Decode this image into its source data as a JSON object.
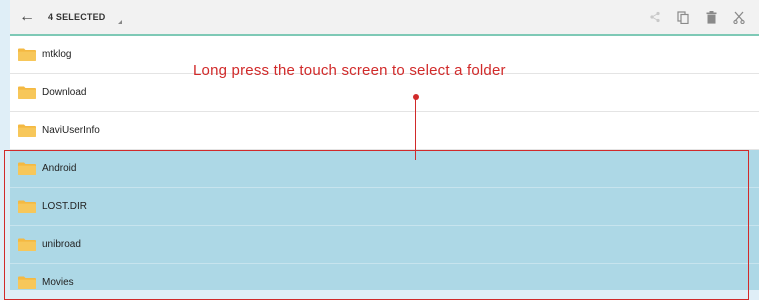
{
  "toolbar": {
    "selection_label": "4 SELECTED",
    "icons": [
      "back-arrow-icon",
      "share-icon",
      "copy-icon",
      "delete-icon",
      "cut-icon"
    ]
  },
  "folders": [
    {
      "name": "mtklog",
      "selected": false
    },
    {
      "name": "Download",
      "selected": false
    },
    {
      "name": "NaviUserInfo",
      "selected": false
    },
    {
      "name": "Android",
      "selected": true
    },
    {
      "name": "LOST.DIR",
      "selected": true
    },
    {
      "name": "unibroad",
      "selected": true
    },
    {
      "name": "Movies",
      "selected": true
    }
  ],
  "annotation": {
    "text": "Long press the touch screen to select a folder",
    "color": "#d12a2a"
  },
  "colors": {
    "selected_row": "#add8e6",
    "toolbar_accent": "#7ec9b6",
    "folder": "#f4b942"
  }
}
